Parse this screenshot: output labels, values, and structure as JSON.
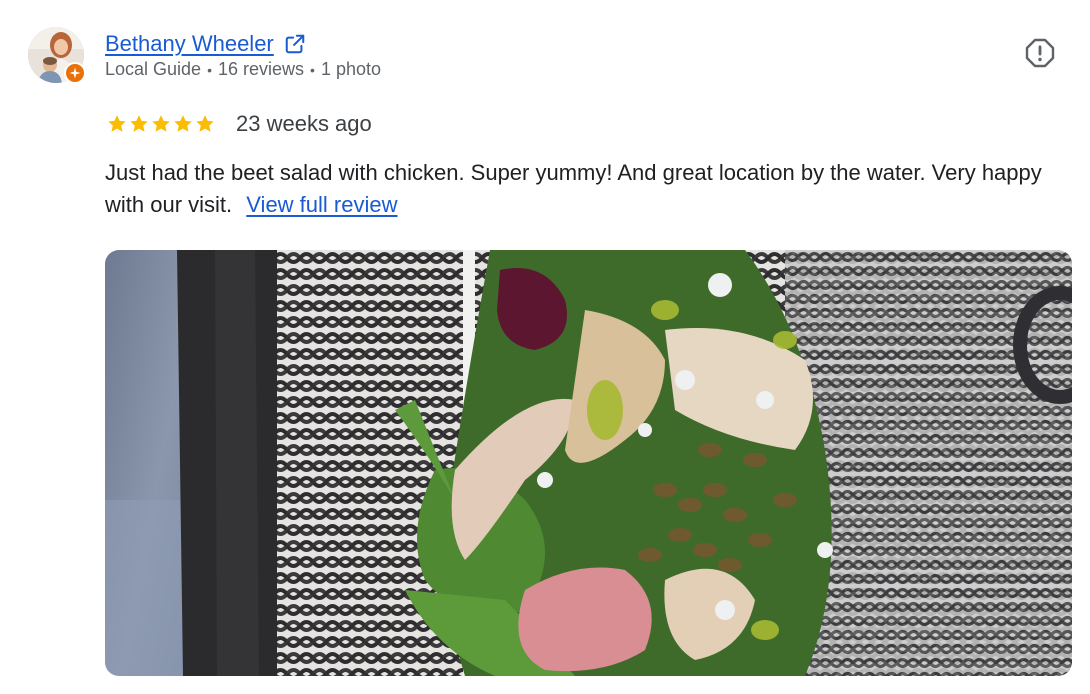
{
  "review": {
    "reviewer_name": "Bethany Wheeler",
    "meta": {
      "badge": "Local Guide",
      "reviews": "16 reviews",
      "photos": "1 photo",
      "separator": "•"
    },
    "rating": 5,
    "rating_max": 5,
    "time_ago": "23 weeks ago",
    "text": "Just had the beet salad with chicken. Super yummy! And great location by the water. Very happy with our visit.",
    "view_full_label": "View full review"
  },
  "icons": {
    "external_link": "external-link-icon",
    "report": "report-icon",
    "local_guide_badge": "local-guide-badge-icon",
    "star": "star-icon"
  },
  "colors": {
    "link": "#1a5ad3",
    "star": "#fbbc04",
    "meta_text": "#5f6368",
    "body_text": "#202124",
    "badge": "#e8710a"
  }
}
